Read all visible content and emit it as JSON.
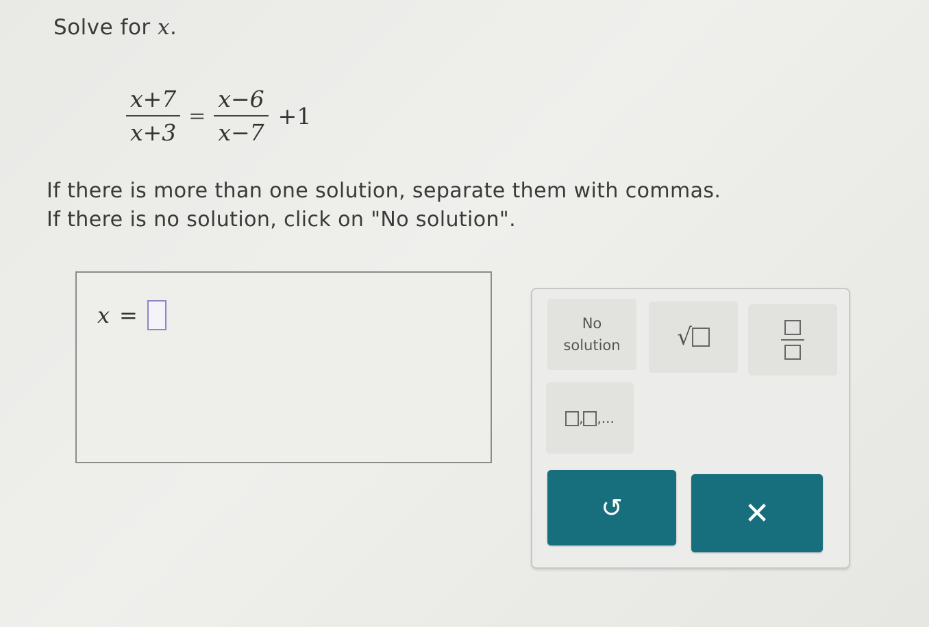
{
  "prompt": {
    "text": "Solve for ",
    "variable": "x",
    "period": "."
  },
  "equation": {
    "lhs_numerator": "x+7",
    "lhs_denominator": "x+3",
    "equals": "=",
    "rhs_numerator": "x−6",
    "rhs_denominator": "x−7",
    "plus_term": "+1"
  },
  "instructions": {
    "line1": "If there is more than one solution, separate them with commas.",
    "line2": "If there is no solution, click on \"No solution\"."
  },
  "answer": {
    "variable": "x",
    "equals": "="
  },
  "keypad": {
    "no_solution_line1": "No",
    "no_solution_line2": "solution",
    "sqrt_symbol": "√",
    "list_separator": ",",
    "list_ellipsis": ",...",
    "undo_icon": "undo-icon",
    "undo_glyph": "↺",
    "clear_icon": "close-icon",
    "clear_glyph": "✕"
  },
  "colors": {
    "action_button": "#176f7d",
    "answer_slot_border": "#8a86c8"
  }
}
